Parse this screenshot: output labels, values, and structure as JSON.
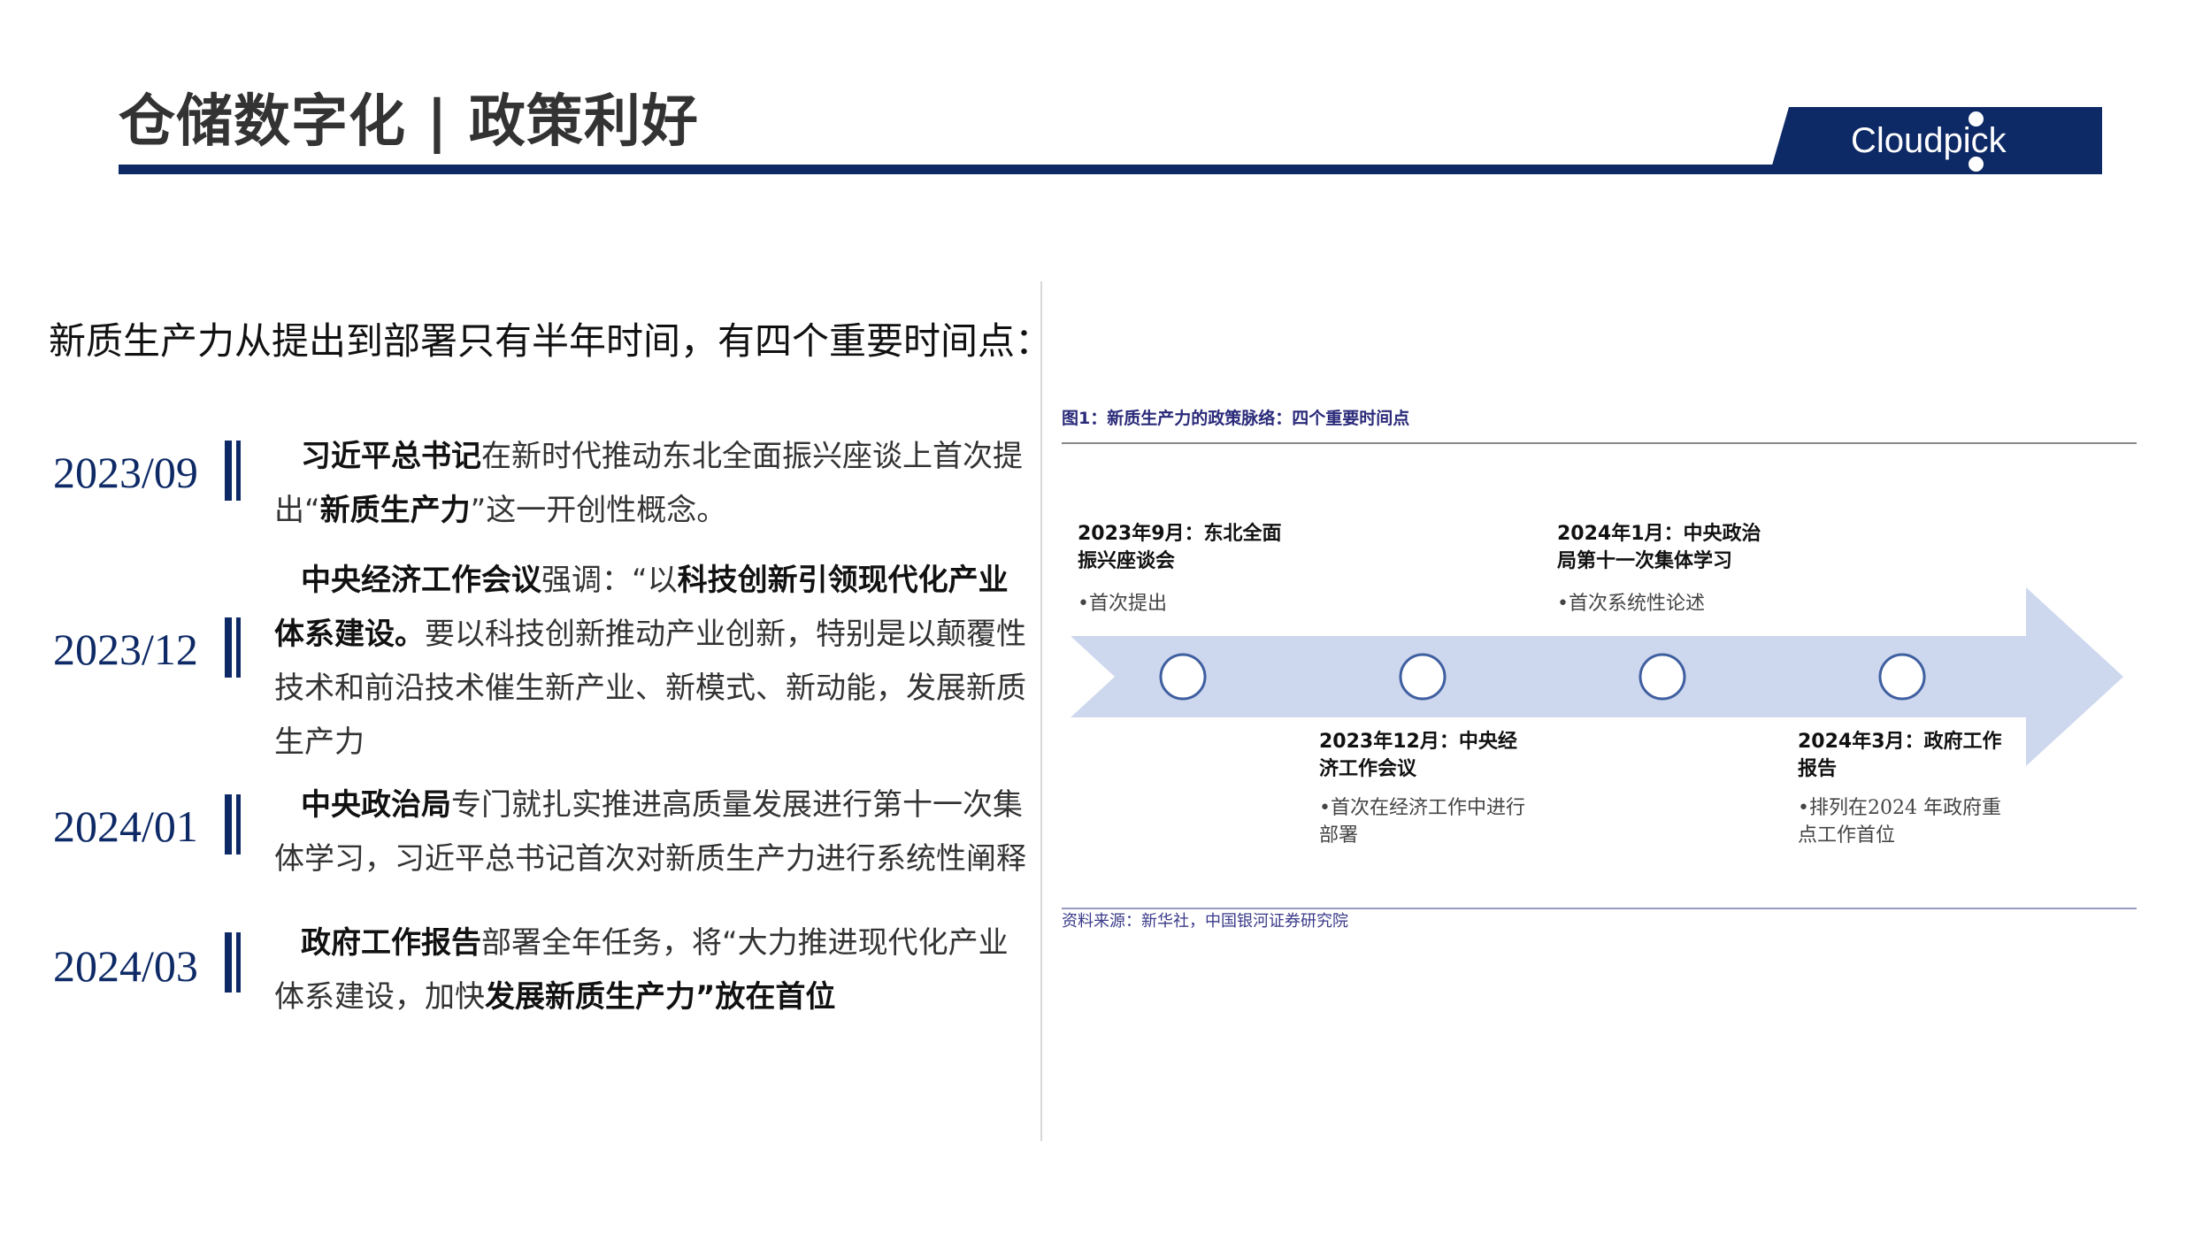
{
  "header": {
    "title": "仓储数字化 | 政策利好",
    "logo_text": "Cloudpick",
    "rule_color": "#0e2a66"
  },
  "left": {
    "intro": "新质生产力从提出到部署只有半年时间，有四个重要时间点：",
    "items": [
      {
        "date": "2023/09",
        "segments": [
          {
            "text": "习近平总书记",
            "hl": true
          },
          {
            "text": "在新时代推动东北全面振兴座谈上首次提出“",
            "hl": false
          },
          {
            "text": "新质生产力",
            "hl": true
          },
          {
            "text": "”这一开创性概念。",
            "hl": false
          }
        ]
      },
      {
        "date": "2023/12",
        "segments": [
          {
            "text": "中央经济工作会议",
            "hl": true
          },
          {
            "text": "强调：“以",
            "hl": false
          },
          {
            "text": "科技创新引领现代化产业体系建设。",
            "hl": true
          },
          {
            "text": "要以科技创新推动产业创新，特别是以颠覆性技术和前沿技术催生新产业、新模式、新动能，发展新质生产力",
            "hl": false
          }
        ]
      },
      {
        "date": "2024/01",
        "segments": [
          {
            "text": "中央政治局",
            "hl": true
          },
          {
            "text": "专门就扎实推进高质量发展进行第十一次集体学习，习近平总书记首次对新质生产力进行系统性阐释",
            "hl": false
          }
        ]
      },
      {
        "date": "2024/03",
        "segments": [
          {
            "text": "政府工作报告",
            "hl": true
          },
          {
            "text": "部署全年任务，将“大力推进现代化产业体系建设，加快",
            "hl": false
          },
          {
            "text": "发展新质生产力”放在首位",
            "hl": true
          }
        ]
      }
    ]
  },
  "figure": {
    "title": "图1：新质生产力的政策脉络：四个重要时间点",
    "source": "资料来源：新华社，中国银河证券研究院",
    "events": [
      {
        "title": "2023年9月：东北全面振兴座谈会",
        "desc": "•首次提出"
      },
      {
        "title": "2023年12月：中央经济工作会议",
        "desc": "•首次在经济工作中进行部署"
      },
      {
        "title": "2024年1月：中央政治局第十一次集体学习",
        "desc": "•首次系统性论述"
      },
      {
        "title": "2024年3月：政府工作报告",
        "desc": "•排列在2024 年政府重点工作首位"
      }
    ],
    "arrow_color": "#cdd7ee",
    "circle_color": "#3f5fa0"
  }
}
